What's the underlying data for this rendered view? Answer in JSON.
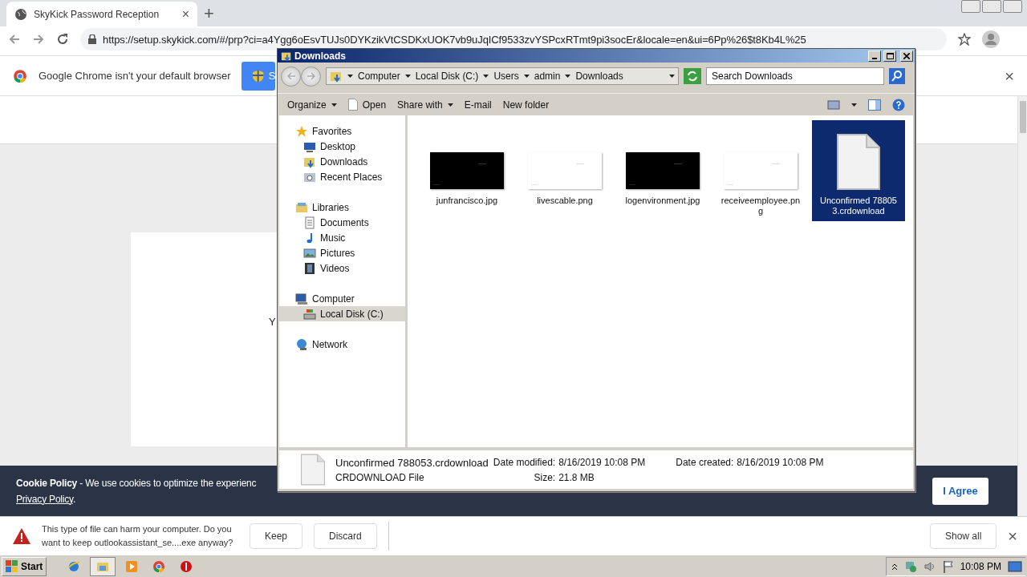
{
  "browser": {
    "tab": {
      "title": "SkyKick Password Reception",
      "close": "×"
    },
    "new_tab": "+",
    "url": "https://setup.skykick.com/#/prp?ci=a4Ygg6oEsvTUJs0DYKzikVtCSDKxUOK7vb9uJqICf9533zvYSPcxRTmt9pi3socEr&locale=en&ui=6Pp%26$t8Kb4L%25",
    "infobar": {
      "message": "Google Chrome isn't your default browser",
      "button": "S",
      "close": "×"
    },
    "page": {
      "card_text": "Y",
      "cookie": {
        "text": "**Cookie Policy** - We use cookies to optimize the experienc",
        "link": "Privacy Policy",
        "tail": ".",
        "button": "I Agree"
      }
    },
    "download_bar": {
      "message": "This type of file can harm your computer. Do you want to keep outlookassistant_se....exe anyway?",
      "buttons": [
        "Keep",
        "Discard"
      ],
      "show_all": "Show all",
      "close": "×"
    }
  },
  "explorer": {
    "title": "Downloads",
    "breadcrumb": [
      "Computer",
      "Local Disk (C:)",
      "Users",
      "admin",
      "Downloads"
    ],
    "search": {
      "placeholder": "Search Downloads"
    },
    "toolbar": [
      {
        "label": "Organize",
        "kind": "menu"
      },
      {
        "label": "Open",
        "kind": "open"
      },
      {
        "label": "Share with",
        "kind": "menu"
      },
      {
        "label": "E-mail",
        "kind": "plain"
      },
      {
        "label": "New folder",
        "kind": "plain"
      }
    ],
    "nav": [
      {
        "label": "Favorites",
        "kind": "favorites",
        "items": [
          {
            "label": "Desktop",
            "kind": "desktop",
            "selected": false
          },
          {
            "label": "Downloads",
            "kind": "downloads",
            "selected": false
          },
          {
            "label": "Recent Places",
            "kind": "recent",
            "selected": false
          }
        ]
      },
      {
        "label": "Libraries",
        "kind": "libraries",
        "items": [
          {
            "label": "Documents",
            "kind": "documents",
            "selected": false
          },
          {
            "label": "Music",
            "kind": "music",
            "selected": false
          },
          {
            "label": "Pictures",
            "kind": "pictures",
            "selected": false
          },
          {
            "label": "Videos",
            "kind": "videos",
            "selected": false
          }
        ]
      },
      {
        "label": "Computer",
        "kind": "computer",
        "items": [
          {
            "label": "Local Disk (C:)",
            "kind": "disk",
            "selected": true
          }
        ]
      },
      {
        "label": "Network",
        "kind": "network"
      }
    ],
    "files": [
      {
        "name": "junfrancisco.jpg",
        "kind": "dark",
        "selected": false
      },
      {
        "name": "livescable.png",
        "kind": "light",
        "selected": false
      },
      {
        "name": "logenvironment.jpg",
        "kind": "dark",
        "selected": false
      },
      {
        "name": "receiveemployee.png",
        "kind": "light",
        "selected": false
      },
      {
        "name": "Unconfirmed 788053.crdownload",
        "kind": "document",
        "selected": true
      }
    ],
    "details": {
      "name": "Unconfirmed 788053.crdownload",
      "type": "CRDOWNLOAD File",
      "fields": [
        {
          "label": "Date modified:",
          "value": "8/16/2019 10:08 PM"
        },
        {
          "label": "Date created:",
          "value": "8/16/2019 10:08 PM"
        },
        {
          "label": "Size:",
          "value": "21.8 MB"
        }
      ]
    }
  },
  "taskbar": {
    "start": "Start",
    "apps": [
      {
        "kind": "ie",
        "selected": false
      },
      {
        "kind": "folder",
        "selected": true
      },
      {
        "kind": "media",
        "selected": false
      },
      {
        "kind": "chrome",
        "selected": false
      },
      {
        "kind": "stop",
        "selected": false
      }
    ],
    "clock": "10:08 PM"
  }
}
